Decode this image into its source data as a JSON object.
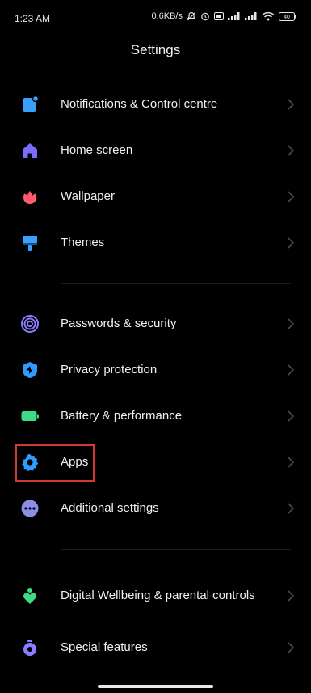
{
  "status_bar": {
    "time": "1:23 AM",
    "network_speed": "0.6KB/s",
    "battery": "40"
  },
  "header": {
    "title": "Settings"
  },
  "groups": [
    {
      "items": [
        {
          "label": "Notifications & Control centre",
          "icon": "notification-icon",
          "color": "#3aa0ff"
        },
        {
          "label": "Home screen",
          "icon": "home-icon",
          "color": "#7b6cff"
        },
        {
          "label": "Wallpaper",
          "icon": "flower-icon",
          "color": "#ff5a6e"
        },
        {
          "label": "Themes",
          "icon": "paint-roller-icon",
          "color": "#3aa0ff"
        }
      ]
    },
    {
      "items": [
        {
          "label": "Passwords & security",
          "icon": "fingerprint-icon",
          "color": "#8a7dff"
        },
        {
          "label": "Privacy protection",
          "icon": "shield-icon",
          "color": "#2f9bff"
        },
        {
          "label": "Battery & performance",
          "icon": "battery-icon",
          "color": "#3ddc84"
        },
        {
          "label": "Apps",
          "icon": "gear-icon",
          "color": "#2f9bff"
        },
        {
          "label": "Additional settings",
          "icon": "more-icon",
          "color": "#8a8fe8"
        }
      ]
    },
    {
      "items": [
        {
          "label": "Digital Wellbeing & parental controls",
          "icon": "wellbeing-icon",
          "color": "#3ddc84"
        },
        {
          "label": "Special features",
          "icon": "special-features-icon",
          "color": "#8a7dff"
        }
      ]
    }
  ]
}
